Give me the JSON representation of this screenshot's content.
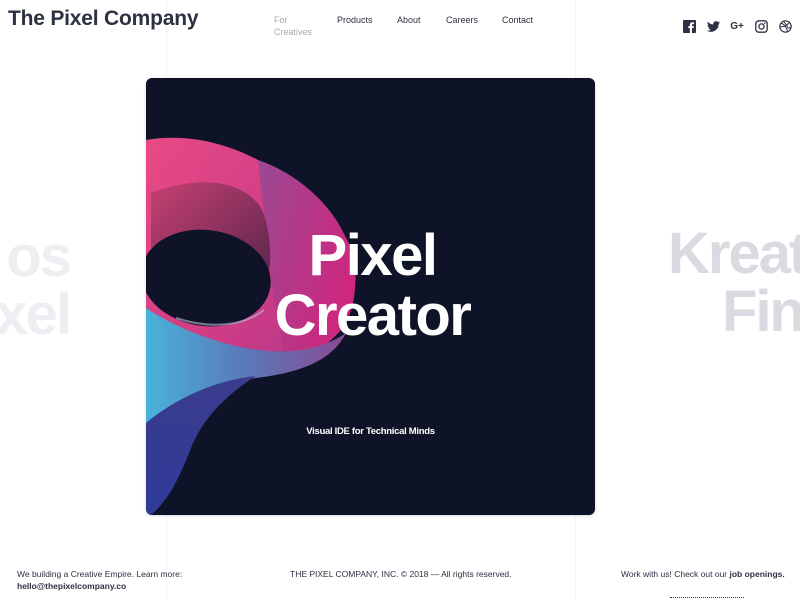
{
  "header": {
    "logo": "The Pixel Company",
    "nav": [
      {
        "label": "For Creatives",
        "active": false,
        "muted": true
      },
      {
        "label": "Products"
      },
      {
        "label": "About"
      },
      {
        "label": "Careers"
      },
      {
        "label": "Contact"
      }
    ],
    "social": [
      "facebook-icon",
      "twitter-icon",
      "google-plus-icon",
      "instagram-icon",
      "dribbble-icon"
    ],
    "google_plus_glyph": "G+"
  },
  "carousel": {
    "prev_slide_text": [
      "os",
      "xel"
    ],
    "next_slide_text": [
      "Kreat",
      "Fin"
    ],
    "active_slide": {
      "title_line1": "Pixel",
      "title_line2": "Creator",
      "subtitle": "Visual IDE for Technical Minds",
      "background": "#0f1327"
    }
  },
  "footer": {
    "left_text": "We building a Creative Empire. Learn more:",
    "email": "hello@thepixelcompany.co",
    "copyright": "THE PIXEL COMPANY, INC. © 2018 — All rights reserved.",
    "right_text": "Work with us! Check out our",
    "right_link": "job openings."
  }
}
